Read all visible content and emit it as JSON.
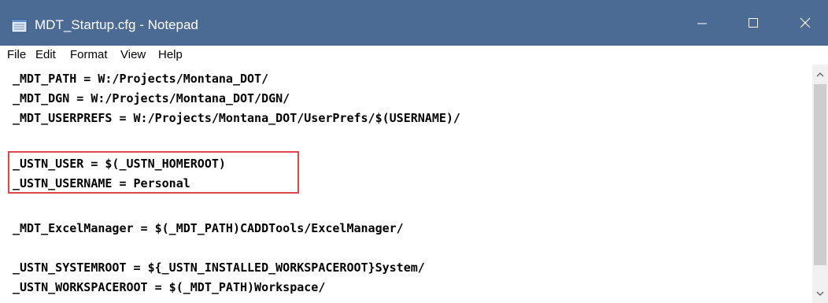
{
  "window": {
    "title": "MDT_Startup.cfg - Notepad",
    "titlebar_color": "#4b6b94",
    "icons": {
      "app": "notepad-icon",
      "minimize": "minimize-icon",
      "maximize": "maximize-icon",
      "close": "close-icon"
    }
  },
  "menu": {
    "items": [
      "File",
      "Edit",
      "Format",
      "View",
      "Help"
    ]
  },
  "editor": {
    "lines": [
      "_MDT_PATH = W:/Projects/Montana_DOT/",
      "_MDT_DGN = W:/Projects/Montana_DOT/DGN/",
      "_MDT_USERPREFS = W:/Projects/Montana_DOT/UserPrefs/$(USERNAME)/",
      "",
      "_USTN_USER = $(_USTN_HOMEROOT)",
      "_USTN_USERNAME = Personal",
      "",
      "_MDT_ExcelManager = $(_MDT_PATH)CADDTools/ExcelManager/",
      "",
      "_USTN_SYSTEMROOT = ${_USTN_INSTALLED_WORKSPACEROOT}System/",
      "_USTN_WORKSPACEROOT = $(_MDT_PATH)Workspace/"
    ],
    "highlight_color": "#e0474c"
  },
  "scrollbar": {
    "icons": {
      "up": "scroll-up-arrow-icon",
      "down": "scroll-down-arrow-icon"
    }
  }
}
